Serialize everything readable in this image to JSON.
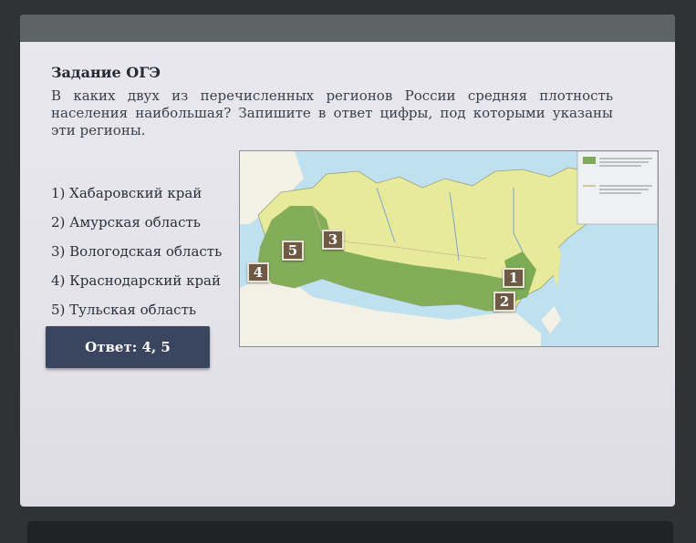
{
  "task": {
    "title": "Задание ОГЭ",
    "question": "В каких двух из перечисленных регионов России средняя плотность населения наибольшая? Запишите в ответ цифры, под которыми указаны эти регионы.",
    "options": [
      "1) Хабаровский край",
      "2) Амурская область",
      "3) Вологодская область",
      "4) Краснодарский край",
      "5) Тульская область"
    ],
    "answer": "Ответ: 4, 5"
  },
  "map": {
    "markers": [
      "1",
      "2",
      "3",
      "4",
      "5"
    ]
  },
  "colors": {
    "answer_bg": "#3a4660",
    "settlement_zone": "#7daa55",
    "territory": "#e7ea9a",
    "water": "#bfe0ef",
    "marker_bg": "#6e5a44"
  }
}
